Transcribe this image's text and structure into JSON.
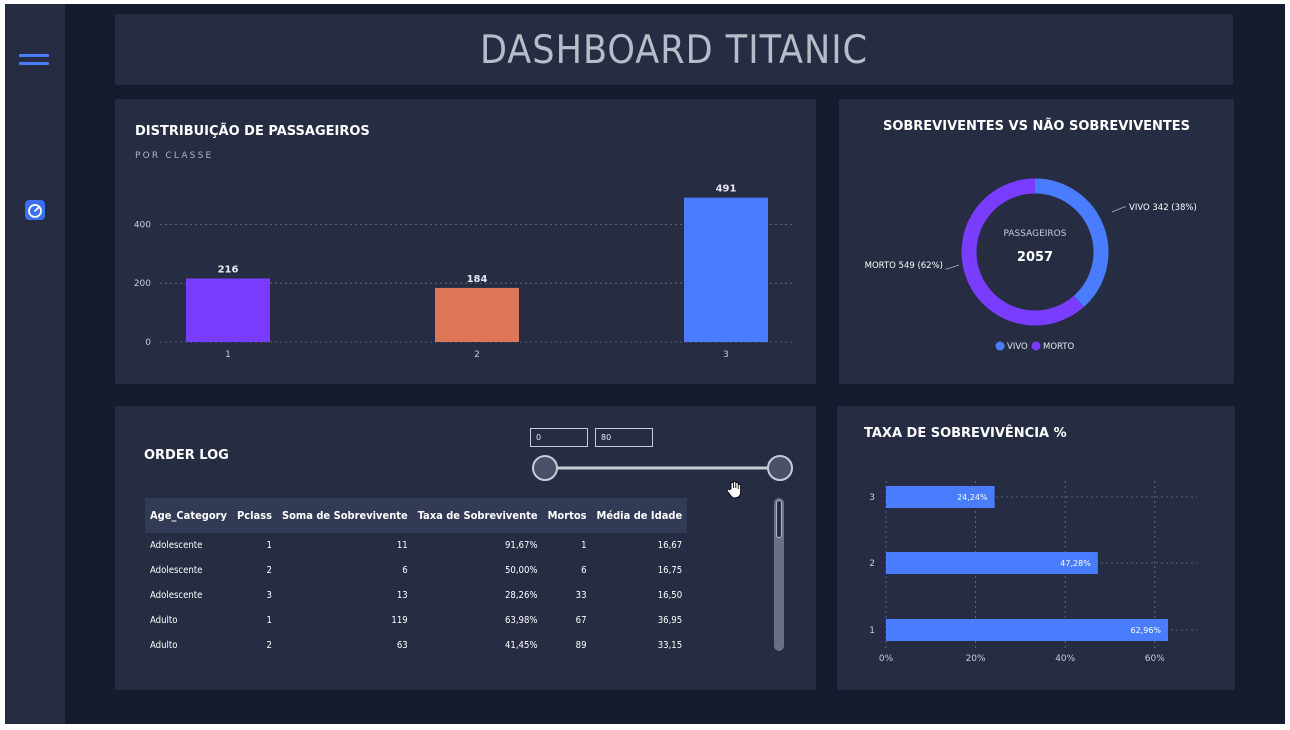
{
  "header": {
    "title": "DASHBOARD TITANIC"
  },
  "sidebar": {
    "items": [
      {
        "icon": "menu-icon"
      },
      {
        "icon": "gauge-icon"
      }
    ]
  },
  "distribution": {
    "title": "DISTRIBUIÇÃO DE PASSAGEIROS",
    "subtitle": "POR CLASSE"
  },
  "donut": {
    "title": "SOBREVIVENTES VS NÃO SOBREVIVENTES",
    "center_label": "PASSAGEIROS",
    "center_value": "2057",
    "label_vivo": "VIVO 342 (38%)",
    "label_morto": "MORTO 549 (62%)",
    "legend": [
      {
        "name": "VIVO",
        "color": "#4a7cff"
      },
      {
        "name": "MORTO",
        "color": "#7a3cff"
      }
    ]
  },
  "order_log": {
    "title": "ORDER LOG",
    "slider_min": "0",
    "slider_max": "80",
    "columns": [
      "Age_Category",
      "Pclass",
      "Soma de Sobrevivente",
      "Taxa de Sobrevivente",
      "Mortos",
      "Média de Idade"
    ],
    "rows": [
      [
        "Adolescente",
        "1",
        "11",
        "91,67%",
        "1",
        "16,67"
      ],
      [
        "Adolescente",
        "2",
        "6",
        "50,00%",
        "6",
        "16,75"
      ],
      [
        "Adolescente",
        "3",
        "13",
        "28,26%",
        "33",
        "16,50"
      ],
      [
        "Adulto",
        "1",
        "119",
        "63,98%",
        "67",
        "36,95"
      ],
      [
        "Adulto",
        "2",
        "63",
        "41,45%",
        "89",
        "33,15"
      ]
    ]
  },
  "survival": {
    "title": "TAXA DE SOBREVIVÊNCIA %"
  },
  "colors": {
    "purple": "#7a3cff",
    "orange": "#dd7755",
    "blue": "#4a7cff",
    "card": "#262c42",
    "bg": "#161c2d"
  },
  "chart_data": [
    {
      "type": "bar",
      "categories": [
        "1",
        "2",
        "3"
      ],
      "values": [
        216,
        184,
        491
      ],
      "data_labels": [
        "216",
        "184",
        "491"
      ],
      "colors": [
        "#7a3cff",
        "#dd7755",
        "#4a7cff"
      ],
      "yticks": [
        "0",
        "200",
        "400"
      ],
      "ylim": [
        0,
        500
      ],
      "grid": true
    },
    {
      "type": "pie",
      "categories": [
        "VIVO",
        "MORTO"
      ],
      "values": [
        342,
        549
      ],
      "percent": [
        38,
        62
      ],
      "colors": [
        "#4a7cff",
        "#7a3cff"
      ],
      "legend": "bottom"
    },
    {
      "type": "bar",
      "orientation": "horizontal",
      "categories": [
        "3",
        "2",
        "1"
      ],
      "values": [
        24.24,
        47.28,
        62.96
      ],
      "data_labels": [
        "24,24%",
        "47,28%",
        "62,96%"
      ],
      "xticks": [
        "0%",
        "20%",
        "40%",
        "60%"
      ],
      "xlim": [
        0,
        70
      ],
      "grid": true
    }
  ]
}
